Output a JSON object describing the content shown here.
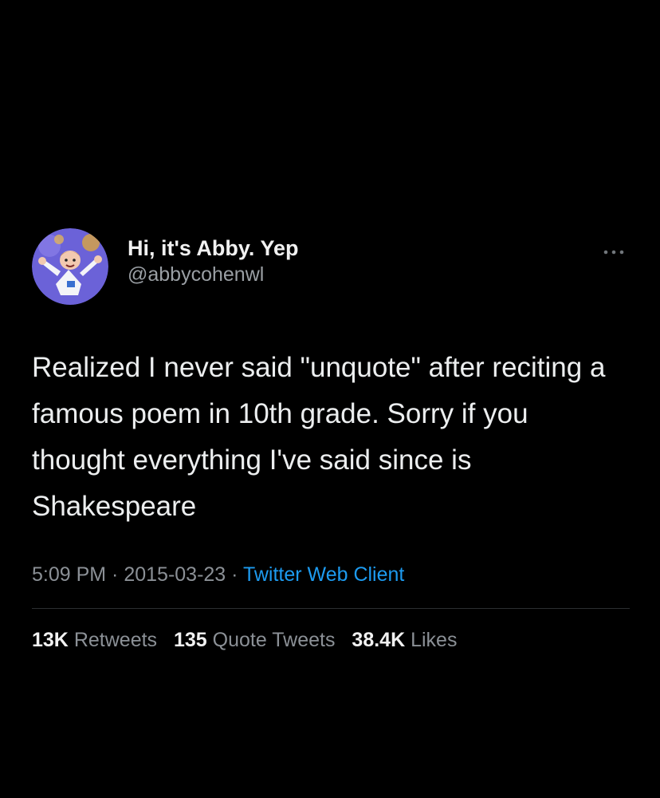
{
  "author": {
    "display_name": "Hi, it's Abby. Yep",
    "handle": "@abbycohenwl",
    "avatar_icon": "cartoon-character-avatar"
  },
  "more_icon": "more-options-icon",
  "tweet": {
    "text": "Realized I never said \"unquote\" after reciting a famous poem in 10th grade. Sorry if you thought everything I've said since is Shakespeare"
  },
  "meta": {
    "time": "5:09 PM",
    "separator": " · ",
    "date": "2015-03-23",
    "source": "Twitter Web Client"
  },
  "stats": [
    {
      "value": "13K",
      "label": "Retweets"
    },
    {
      "value": "135",
      "label": "Quote Tweets"
    },
    {
      "value": "38.4K",
      "label": "Likes"
    }
  ],
  "colors": {
    "background": "#000000",
    "text": "#e7e9ea",
    "secondary": "#8b9096",
    "link": "#1d9bf0",
    "avatar_bg": "#6b62d8"
  }
}
